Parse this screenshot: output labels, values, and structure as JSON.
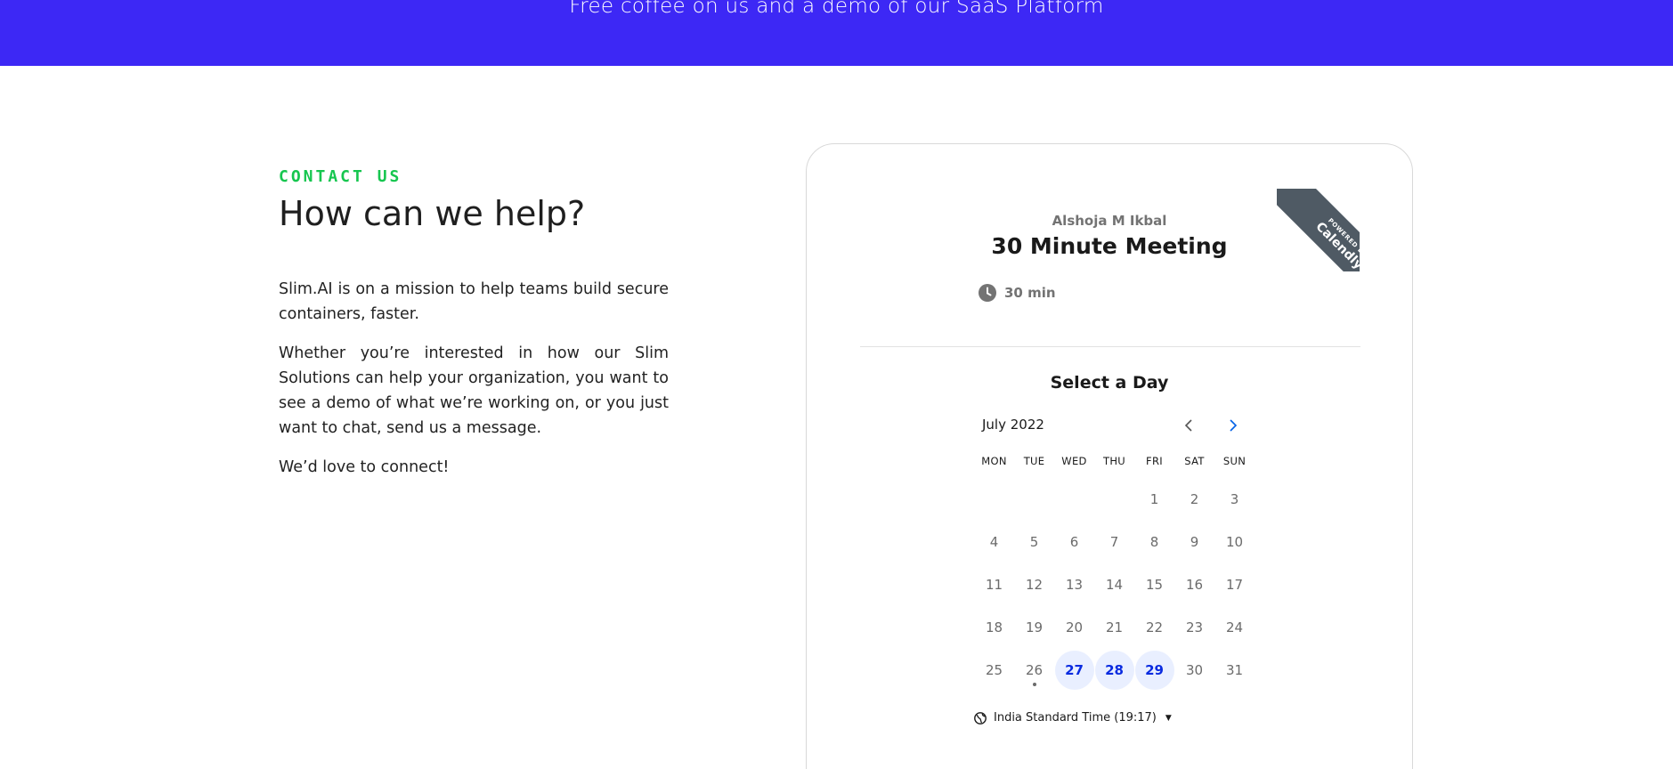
{
  "banner": {
    "text": "Free coffee on us and a demo of our SaaS Platform",
    "color": "#3d28f5"
  },
  "contact": {
    "eyebrow": "CONTACT US",
    "heading": "How can we help?",
    "paragraphs": [
      "Slim.AI is on a mission to help teams build secure containers, faster.",
      "Whether you’re interested in how our Slim Solutions can help your organization, you want to see a demo of what we’re working on, or you just want to chat, send us a message.",
      "We’d love to connect!"
    ]
  },
  "calendly": {
    "ribbon_small": "POWERED BY",
    "ribbon_brand": "Calendly",
    "host": "Alshoja M Ikbal",
    "title": "30 Minute Meeting",
    "duration": "30 min",
    "select_day": "Select a Day",
    "month": "July 2022",
    "weekdays": [
      "MON",
      "TUE",
      "WED",
      "THU",
      "FRI",
      "SAT",
      "SUN"
    ],
    "days": [
      "1",
      "2",
      "3",
      "4",
      "5",
      "6",
      "7",
      "8",
      "9",
      "10",
      "11",
      "12",
      "13",
      "14",
      "15",
      "16",
      "17",
      "18",
      "19",
      "20",
      "21",
      "22",
      "23",
      "24",
      "25",
      "26",
      "27",
      "28",
      "29",
      "30",
      "31"
    ],
    "available_days": [
      "27",
      "28",
      "29"
    ],
    "today": "26",
    "timezone": "India Standard Time (19:17)",
    "accent_color": "#0a2be0"
  }
}
